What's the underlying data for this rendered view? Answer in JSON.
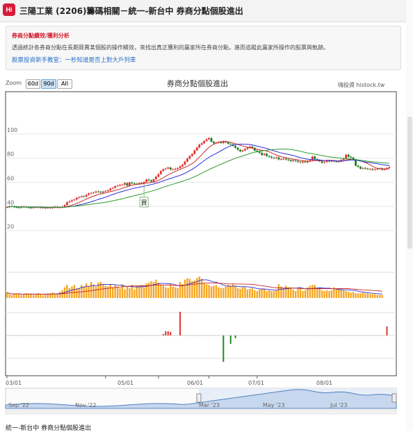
{
  "header": {
    "logo_text": "Hi",
    "title": "三陽工業 (2206)籌碼相關－統一-新台中 券商分點個股進出"
  },
  "info": {
    "heading": "券商分點績效/獲利分析",
    "description": "透過統計各券商分點在長期買賣某個股的操作績效，來找出真正獲利的贏家所在券商分點，進而追蹤此贏家所操作的股票與軌跡。",
    "link": "股票投資新手教室：一秒知道是否上對大戶列車"
  },
  "zoom": {
    "label": "Zoom",
    "buttons": [
      "60d",
      "90d",
      "All"
    ],
    "selected": "90d"
  },
  "credit": "嗨投資 histock.tw",
  "bottom_title": "統一-新台中 券商分點個股進出",
  "colors": {
    "up": "#e03131",
    "down": "#1f7a1f",
    "ma_short": "#2b2bd6",
    "ma_mid": "#c62828",
    "ma_long": "#2e9a2e",
    "volume": "#f5a623",
    "buy": "#e03131",
    "sell": "#1f8a1f",
    "navigator_line": "#4f81bd"
  },
  "chart_data": {
    "title": "券商分點個股進出",
    "type": "line",
    "y_ticks": [
      20,
      40,
      60,
      80,
      100
    ],
    "ylim": [
      8,
      112
    ],
    "x_ticks": [
      "03/01",
      "05/01",
      "06/01",
      "07/01",
      "08/01"
    ],
    "price_series_desc": "daily candlestick close prices (approx.)",
    "close": [
      39.5,
      40.2,
      40.1,
      39.6,
      39.3,
      39.0,
      39.8,
      39.7,
      39.4,
      39.1,
      38.9,
      39.3,
      39.6,
      39.1,
      39.3,
      38.8,
      38.9,
      39.2,
      38.7,
      39.4,
      39.8,
      39.3,
      39.5,
      39.8,
      41.2,
      43.5,
      44.3,
      45.2,
      45.8,
      47.2,
      47.8,
      48.5,
      48.2,
      49.6,
      50.8,
      51.2,
      51.6,
      52.4,
      52.2,
      51.5,
      52.3,
      52.9,
      53.4,
      54.8,
      55.4,
      56.8,
      57.3,
      57.9,
      58.1,
      59.4,
      57.3,
      59.8,
      59.1,
      58.8,
      58.6,
      59.4,
      59.1,
      60.3,
      62.3,
      61.6,
      60.6,
      62.6,
      64.6,
      66.8,
      69.3,
      70.8,
      71.4,
      72.2,
      70.6,
      70.8,
      71.2,
      71.8,
      73.2,
      74.6,
      77.2,
      79.6,
      81.8,
      83.4,
      86.4,
      88.8,
      91.2,
      92.3,
      94.2,
      95.6,
      96.6,
      93.6,
      92.3,
      92.8,
      93.3,
      92.5,
      93.8,
      93.1,
      91.9,
      91.4,
      90.2,
      88.6,
      86.9,
      85.6,
      86.4,
      87.6,
      88.6,
      89.6,
      88.5,
      86.2,
      85.5,
      84.4,
      82.6,
      83.6,
      81.8,
      81.2,
      80.4,
      80.1,
      80.6,
      78.9,
      79.2,
      79.6,
      78.9,
      78.3,
      77.5,
      78.2,
      77.6,
      76.9,
      76.4,
      77.2,
      76.6,
      77.5,
      78.4,
      81.3,
      79.2,
      78.4,
      77.4,
      76.2,
      76.8,
      78.1,
      77.3,
      77.9,
      77.4,
      76.9,
      77.6,
      78.5,
      79.5,
      82.8,
      81.1,
      80.5,
      78.7,
      73.8,
      72.8,
      71.3,
      71.9,
      71.4,
      70.9,
      71.0,
      70.4,
      70.9,
      71.1,
      71.6,
      70.4,
      71.1,
      71.8,
      72.6
    ],
    "ma_short": [
      40,
      40,
      40,
      40,
      40,
      40,
      40,
      40,
      40,
      40,
      40,
      40,
      40,
      40,
      40,
      40,
      40,
      40,
      40,
      40,
      40,
      40,
      40,
      40,
      40,
      40,
      40,
      40,
      40,
      41,
      41,
      42,
      42,
      43,
      44,
      44,
      45,
      46,
      46,
      47,
      48,
      48,
      49,
      50,
      50,
      51,
      51,
      52,
      52,
      53,
      53,
      54,
      55,
      55,
      56,
      57,
      57,
      58,
      58,
      58,
      58,
      59,
      59,
      60,
      61,
      61,
      62,
      63,
      64,
      65,
      66,
      67,
      68,
      68,
      69,
      70,
      71,
      72,
      73,
      75,
      76,
      78,
      79,
      81,
      83,
      84,
      86,
      87,
      88,
      89,
      90,
      91,
      91,
      92,
      92,
      93,
      92,
      92,
      91,
      90,
      90,
      89,
      89,
      88,
      88,
      87,
      87,
      86,
      86,
      85,
      84,
      84,
      83,
      82,
      82,
      81,
      81,
      80,
      80,
      79,
      79,
      79,
      78,
      78,
      78,
      78,
      78,
      78,
      78,
      78,
      78,
      78,
      78,
      78,
      78,
      78,
      78,
      78,
      78,
      78,
      78,
      78,
      78,
      78,
      77,
      77,
      76,
      75,
      75,
      74,
      74,
      73,
      73,
      72,
      72,
      72,
      72,
      72,
      72
    ],
    "volume": [
      7,
      5,
      4,
      5,
      6,
      5,
      4,
      5,
      6,
      5,
      5,
      4,
      5,
      6,
      5,
      4,
      5,
      6,
      6,
      7,
      5,
      6,
      8,
      10,
      14,
      17,
      13,
      15,
      17,
      12,
      13,
      17,
      15,
      19,
      15,
      21,
      18,
      15,
      20,
      21,
      18,
      16,
      15,
      18,
      14,
      17,
      15,
      13,
      18,
      11,
      15,
      13,
      17,
      11,
      16,
      16,
      17,
      14,
      19,
      20,
      22,
      21,
      24,
      20,
      17,
      16,
      14,
      13,
      18,
      15,
      14,
      13,
      21,
      18,
      24,
      26,
      25,
      22,
      23,
      26,
      28,
      25,
      20,
      18,
      17,
      15,
      16,
      17,
      14,
      13,
      13,
      15,
      17,
      16,
      18,
      16,
      13,
      12,
      14,
      14,
      11,
      12,
      13,
      10,
      9,
      11,
      12,
      12,
      9,
      10,
      9,
      9,
      10,
      18,
      15,
      13,
      16,
      14,
      14,
      11,
      9,
      12,
      13,
      9,
      10,
      14,
      16,
      17,
      17,
      13,
      12,
      10,
      9,
      10,
      9,
      10,
      14,
      12,
      12,
      11,
      10,
      9,
      8,
      7,
      8,
      6,
      6,
      6,
      7,
      6,
      6,
      5,
      5,
      5,
      4,
      4,
      4
    ],
    "net_buysell": [
      0,
      0,
      0,
      0,
      0,
      0,
      0,
      0,
      0,
      0,
      0,
      0,
      0,
      0,
      0,
      0,
      0,
      0,
      0,
      0,
      0,
      0,
      0,
      0,
      0,
      0,
      0,
      0,
      0,
      0,
      0,
      0,
      0,
      0,
      0,
      0,
      0,
      0,
      0,
      0,
      0,
      0,
      0,
      0,
      0,
      0,
      0,
      0,
      0,
      0,
      0,
      0,
      0,
      0,
      0,
      0,
      0,
      0,
      0,
      0,
      0,
      0,
      0,
      0,
      0,
      2,
      2,
      2,
      0,
      0,
      0,
      0,
      0,
      0,
      0,
      0,
      0,
      0,
      0,
      0,
      0,
      0,
      0,
      0,
      0,
      0,
      0,
      0,
      0,
      0,
      0,
      0,
      0,
      0,
      0,
      0,
      0,
      0,
      0,
      0,
      0,
      0,
      0,
      0,
      0,
      0,
      0,
      0,
      0,
      0,
      0,
      0,
      0,
      0,
      0,
      0,
      0,
      0,
      0,
      0,
      0,
      0,
      0,
      0,
      0,
      0,
      0,
      0,
      0,
      0,
      0,
      0,
      0,
      0,
      0,
      0,
      0,
      0,
      0,
      0,
      0,
      0,
      0,
      0,
      0,
      0,
      0,
      0,
      0,
      0,
      0,
      0,
      0,
      0,
      0,
      0,
      0,
      0,
      4
    ],
    "buy_marker_label": "買",
    "navigator_labels": [
      "Sep '22",
      "Nov '22",
      "Mar '23",
      "May '23",
      "Jul '23"
    ]
  }
}
